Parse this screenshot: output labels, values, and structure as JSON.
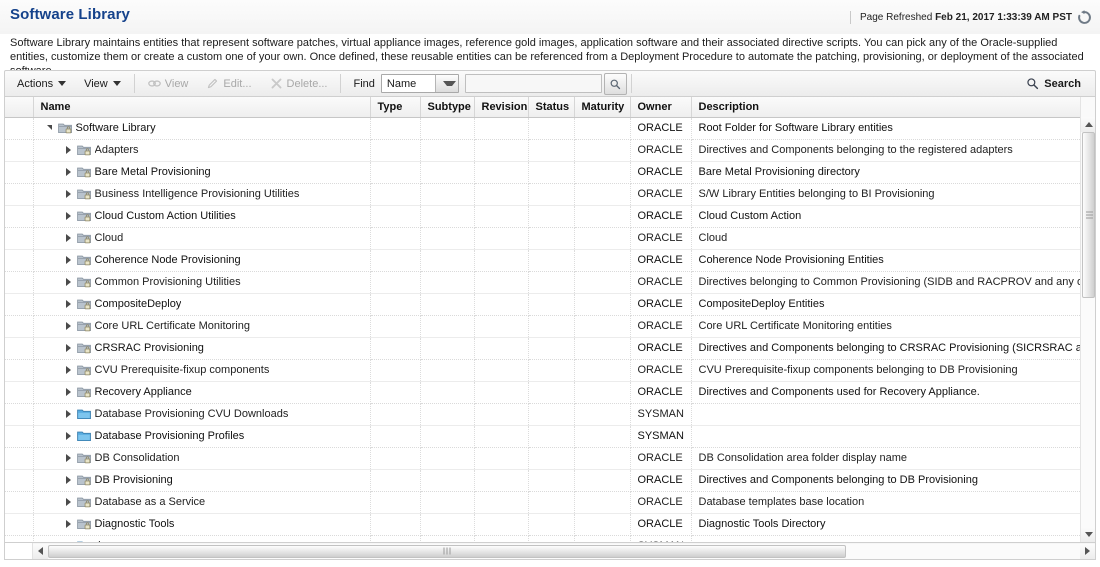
{
  "header": {
    "title": "Software Library",
    "refresh_prefix": "Page Refreshed",
    "refresh_timestamp": "Feb 21, 2017 1:33:39 AM PST",
    "refresh_icon": "refresh-icon",
    "title_color": "#15428b"
  },
  "description": "Software Library maintains entities that represent software patches, virtual appliance images, reference gold images, application software and their associated directive scripts. You can pick any of the Oracle-supplied entities, customize them or create a custom one of your own. Once defined, these reusable entities can be referenced from a Deployment Procedure to automate the patching, provisioning, or deployment of the associated software.",
  "toolbar": {
    "actions_label": "Actions",
    "view_menu_label": "View",
    "view_button_label": "View",
    "edit_button_label": "Edit...",
    "delete_button_label": "Delete...",
    "find_label": "Find",
    "find_field_selected": "Name",
    "find_field_options": [
      "Name"
    ],
    "find_input_value": "",
    "find_input_placeholder": "",
    "find_go_icon": "magnifier-icon",
    "search_link_label": "Search",
    "search_link_icon": "magnifier-icon"
  },
  "table": {
    "columns": [
      "Name",
      "Type",
      "Subtype",
      "Revision",
      "Status",
      "Maturity",
      "Owner",
      "Description"
    ],
    "rows": [
      {
        "name": "Software Library",
        "indent": 0,
        "state": "expanded",
        "icon": "locked-folder-icon",
        "type": "",
        "subtype": "",
        "revision": "",
        "status": "",
        "maturity": "",
        "owner": "ORACLE",
        "description": "Root Folder for Software Library entities"
      },
      {
        "name": "Adapters",
        "indent": 1,
        "state": "collapsed",
        "icon": "locked-folder-icon",
        "type": "",
        "subtype": "",
        "revision": "",
        "status": "",
        "maturity": "",
        "owner": "ORACLE",
        "description": "Directives and Components belonging to the registered adapters"
      },
      {
        "name": "Bare Metal Provisioning",
        "indent": 1,
        "state": "collapsed",
        "icon": "locked-folder-icon",
        "type": "",
        "subtype": "",
        "revision": "",
        "status": "",
        "maturity": "",
        "owner": "ORACLE",
        "description": "Bare Metal Provisioning directory"
      },
      {
        "name": "Business Intelligence Provisioning Utilities",
        "indent": 1,
        "state": "collapsed",
        "icon": "locked-folder-icon",
        "type": "",
        "subtype": "",
        "revision": "",
        "status": "",
        "maturity": "",
        "owner": "ORACLE",
        "description": "S/W Library Entities belonging to BI Provisioning"
      },
      {
        "name": "Cloud Custom Action Utilities",
        "indent": 1,
        "state": "collapsed",
        "icon": "locked-folder-icon",
        "type": "",
        "subtype": "",
        "revision": "",
        "status": "",
        "maturity": "",
        "owner": "ORACLE",
        "description": "Cloud Custom Action"
      },
      {
        "name": "Cloud",
        "indent": 1,
        "state": "collapsed",
        "icon": "locked-folder-icon",
        "type": "",
        "subtype": "",
        "revision": "",
        "status": "",
        "maturity": "",
        "owner": "ORACLE",
        "description": "Cloud"
      },
      {
        "name": "Coherence Node Provisioning",
        "indent": 1,
        "state": "collapsed",
        "icon": "locked-folder-icon",
        "type": "",
        "subtype": "",
        "revision": "",
        "status": "",
        "maturity": "",
        "owner": "ORACLE",
        "description": "Coherence Node Provisioning Entities"
      },
      {
        "name": "Common Provisioning Utilities",
        "indent": 1,
        "state": "collapsed",
        "icon": "locked-folder-icon",
        "type": "",
        "subtype": "",
        "revision": "",
        "status": "",
        "maturity": "",
        "owner": "ORACLE",
        "description": "Directives belonging to Common Provisioning (SIDB and RACPROV and any other)"
      },
      {
        "name": "CompositeDeploy",
        "indent": 1,
        "state": "collapsed",
        "icon": "locked-folder-icon",
        "type": "",
        "subtype": "",
        "revision": "",
        "status": "",
        "maturity": "",
        "owner": "ORACLE",
        "description": "CompositeDeploy Entities"
      },
      {
        "name": "Core URL Certificate Monitoring",
        "indent": 1,
        "state": "collapsed",
        "icon": "locked-folder-icon",
        "type": "",
        "subtype": "",
        "revision": "",
        "status": "",
        "maturity": "",
        "owner": "ORACLE",
        "description": "Core URL Certificate Monitoring entities"
      },
      {
        "name": "CRSRAC Provisioning",
        "indent": 1,
        "state": "collapsed",
        "icon": "locked-folder-icon",
        "type": "",
        "subtype": "",
        "revision": "",
        "status": "",
        "maturity": "",
        "owner": "ORACLE",
        "description": "Directives and Components belonging to CRSRAC Provisioning (SICRSRAC and RACPROV)"
      },
      {
        "name": "CVU Prerequisite-fixup components",
        "indent": 1,
        "state": "collapsed",
        "icon": "locked-folder-icon",
        "type": "",
        "subtype": "",
        "revision": "",
        "status": "",
        "maturity": "",
        "owner": "ORACLE",
        "description": "CVU Prerequisite-fixup components belonging to DB Provisioning"
      },
      {
        "name": "Recovery Appliance",
        "indent": 1,
        "state": "collapsed",
        "icon": "locked-folder-icon",
        "type": "",
        "subtype": "",
        "revision": "",
        "status": "",
        "maturity": "",
        "owner": "ORACLE",
        "description": "Directives and Components used for Recovery Appliance."
      },
      {
        "name": "Database Provisioning CVU Downloads",
        "indent": 1,
        "state": "collapsed",
        "icon": "folder-icon",
        "type": "",
        "subtype": "",
        "revision": "",
        "status": "",
        "maturity": "",
        "owner": "SYSMAN",
        "description": ""
      },
      {
        "name": "Database Provisioning Profiles",
        "indent": 1,
        "state": "collapsed",
        "icon": "folder-icon",
        "type": "",
        "subtype": "",
        "revision": "",
        "status": "",
        "maturity": "",
        "owner": "SYSMAN",
        "description": ""
      },
      {
        "name": "DB Consolidation",
        "indent": 1,
        "state": "collapsed",
        "icon": "locked-folder-icon",
        "type": "",
        "subtype": "",
        "revision": "",
        "status": "",
        "maturity": "",
        "owner": "ORACLE",
        "description": "DB Consolidation area folder display name"
      },
      {
        "name": "DB Provisioning",
        "indent": 1,
        "state": "collapsed",
        "icon": "locked-folder-icon",
        "type": "",
        "subtype": "",
        "revision": "",
        "status": "",
        "maturity": "",
        "owner": "ORACLE",
        "description": "Directives and Components belonging to DB Provisioning"
      },
      {
        "name": "Database as a Service",
        "indent": 1,
        "state": "collapsed",
        "icon": "locked-folder-icon",
        "type": "",
        "subtype": "",
        "revision": "",
        "status": "",
        "maturity": "",
        "owner": "ORACLE",
        "description": "Database templates base location"
      },
      {
        "name": "Diagnostic Tools",
        "indent": 1,
        "state": "collapsed",
        "icon": "locked-folder-icon",
        "type": "",
        "subtype": "",
        "revision": "",
        "status": "",
        "maturity": "",
        "owner": "ORACLE",
        "description": "Diagnostic Tools Directory"
      },
      {
        "name": "dummy",
        "indent": 1,
        "state": "collapsed",
        "icon": "folder-icon",
        "type": "",
        "subtype": "",
        "revision": "",
        "status": "",
        "maturity": "",
        "owner": "SYSMAN",
        "description": ""
      }
    ]
  },
  "scrollbars": {
    "vertical_up_icon": "scroll-up-icon",
    "vertical_down_icon": "scroll-down-icon",
    "horizontal_left_icon": "scroll-left-icon",
    "horizontal_right_icon": "scroll-right-icon"
  }
}
